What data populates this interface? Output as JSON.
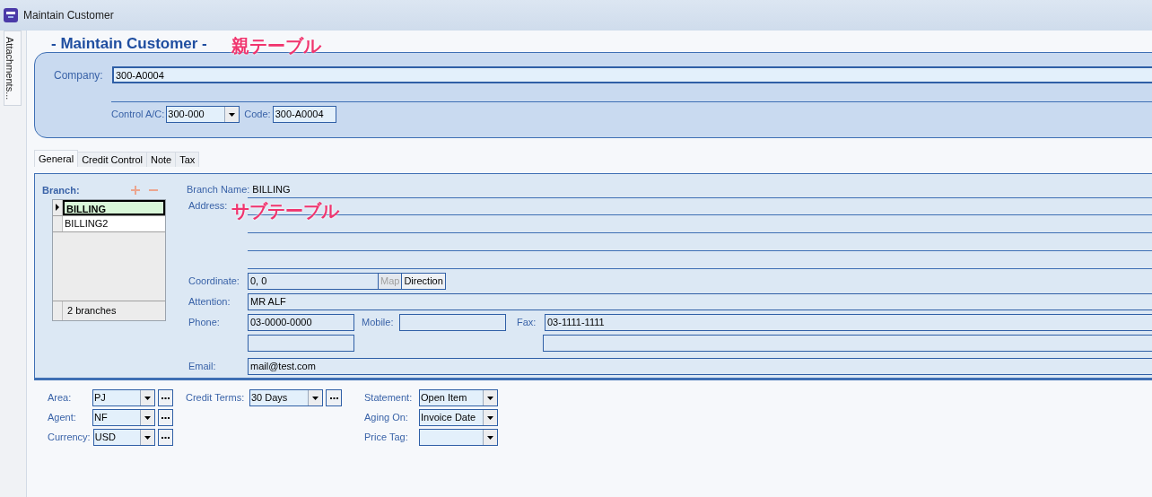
{
  "window": {
    "title": "Maintain Customer"
  },
  "side_tab": {
    "label": "Attachments..."
  },
  "header": {
    "title": "- Maintain Customer -"
  },
  "annotations": [
    {
      "text": "親テーブル"
    },
    {
      "text": "サブテーブル"
    }
  ],
  "company": {
    "label": "Company:",
    "value": "300-A0004"
  },
  "control_ac": {
    "label": "Control A/C:",
    "value": "300-000"
  },
  "code": {
    "label": "Code:",
    "value": "300-A0004"
  },
  "tabs": [
    {
      "label": "General",
      "selected": true
    },
    {
      "label": "Credit Control",
      "selected": false
    },
    {
      "label": "Note",
      "selected": false
    },
    {
      "label": "Tax",
      "selected": false
    }
  ],
  "branch": {
    "label": "Branch:",
    "rows": [
      {
        "name": "BILLING",
        "selected": true
      },
      {
        "name": "BILLING2",
        "selected": false
      }
    ],
    "footer": "2 branches"
  },
  "details": {
    "branch_name": {
      "label": "Branch Name:",
      "value": "BILLING"
    },
    "address": {
      "label": "Address:"
    },
    "coordinate": {
      "label": "Coordinate:",
      "value": "0, 0",
      "buttons": [
        {
          "label": "Map",
          "disabled": true
        },
        {
          "label": "Direction",
          "disabled": false
        }
      ]
    },
    "attention": {
      "label": "Attention:",
      "value": "MR ALF"
    },
    "phone": {
      "label": "Phone:",
      "value": "03-0000-0000"
    },
    "mobile": {
      "label": "Mobile:"
    },
    "fax": {
      "label": "Fax:",
      "value": "03-1111-1111"
    },
    "email": {
      "label": "Email:",
      "value": "mail@test.com"
    }
  },
  "bottom_columns": [
    [
      {
        "label": "Area:",
        "value": "PJ",
        "lookup": true
      },
      {
        "label": "Agent:",
        "value": "NF",
        "lookup": true
      },
      {
        "label": "Currency:",
        "value": "USD",
        "lookup": true
      }
    ],
    [
      {
        "label": "Credit Terms:",
        "value": "30 Days",
        "lookup": true
      }
    ],
    [
      {
        "label": "Statement:",
        "value": "Open Item",
        "lookup": false
      },
      {
        "label": "Aging On:",
        "value": "Invoice Date",
        "lookup": false
      },
      {
        "label": "Price Tag:",
        "lookup": false
      }
    ]
  ]
}
